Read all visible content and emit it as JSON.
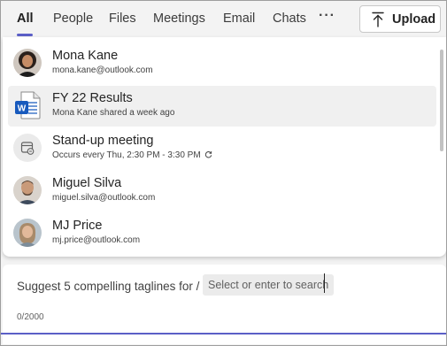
{
  "tabs": [
    {
      "label": "All",
      "active": true
    },
    {
      "label": "People"
    },
    {
      "label": "Files"
    },
    {
      "label": "Meetings"
    },
    {
      "label": "Email"
    },
    {
      "label": "Chats"
    }
  ],
  "more_label": "···",
  "upload": {
    "label": "Upload",
    "icon": "upload-icon"
  },
  "results": [
    {
      "type": "person",
      "title": "Mona Kane",
      "subtitle": "mona.kane@outlook.com",
      "icon": "avatar"
    },
    {
      "type": "file",
      "title": "FY 22 Results",
      "subtitle": "Mona Kane shared a week ago",
      "icon": "word-file-icon"
    },
    {
      "type": "meeting",
      "title": "Stand-up meeting",
      "subtitle": "Occurs every Thu, 2:30 PM - 3:30 PM",
      "icon": "calendar-icon"
    },
    {
      "type": "person",
      "title": "Miguel Silva",
      "subtitle": "miguel.silva@outlook.com",
      "icon": "avatar"
    },
    {
      "type": "person",
      "title": "MJ Price",
      "subtitle": "mj.price@outlook.com",
      "icon": "avatar"
    }
  ],
  "compose": {
    "prompt": "Suggest 5 compelling taglines for /",
    "chip_placeholder": "Select or enter to search",
    "counter": "0/2000"
  },
  "colors": {
    "accent": "#5b5fc7",
    "word_blue": "#185abd"
  }
}
